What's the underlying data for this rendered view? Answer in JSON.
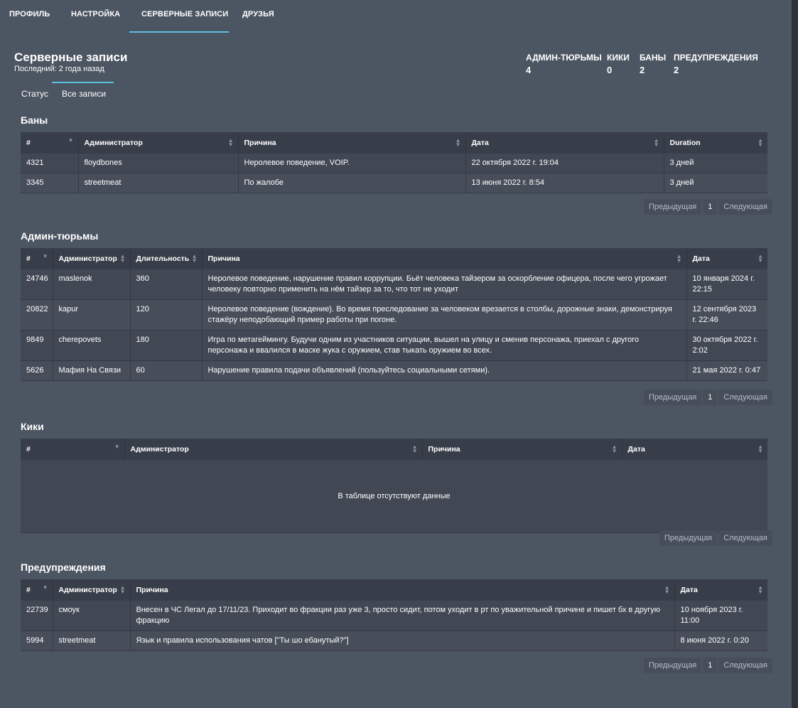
{
  "nav": {
    "tabs": [
      "ПРОФИЛЬ",
      "НАСТРОЙКА",
      "СЕРВЕРНЫЕ ЗАПИСИ",
      "ДРУЗЬЯ"
    ]
  },
  "header": {
    "title": "Серверные записи",
    "subtitle": "Последний: 2 года назад"
  },
  "stats": [
    {
      "label": "АДМИН-ТЮРЬМЫ",
      "value": "4"
    },
    {
      "label": "КИКИ",
      "value": "0"
    },
    {
      "label": "БАНЫ",
      "value": "2"
    },
    {
      "label": "ПРЕДУПРЕЖДЕНИЯ",
      "value": "2"
    }
  ],
  "subtabs": [
    "Статус",
    "Все записи"
  ],
  "pager": {
    "prev": "Предыдущая",
    "next": "Следующая",
    "page": "1"
  },
  "bans": {
    "title": "Баны",
    "columns": [
      "#",
      "Администратор",
      "Причина",
      "Дата",
      "Duration"
    ],
    "rows": [
      [
        "4321",
        "floydbones",
        "Неролевое поведение, VOIP.",
        "22 октября 2022 г. 19:04",
        "3 дней"
      ],
      [
        "3345",
        "streetmeat",
        "По жалобе",
        "13 июня 2022 г. 8:54",
        "3 дней"
      ]
    ]
  },
  "jails": {
    "title": "Админ-тюрьмы",
    "columns": [
      "#",
      "Администратор",
      "Длительность",
      "Причина",
      "Дата"
    ],
    "rows": [
      [
        "24746",
        "maslenok",
        "360",
        "Неролевое поведение, нарушение правил коррупции. Бьёт человека тайзером за оскорбление офицера, после чего угрожает человеку повторно применить на нём тайзер за то, что тот не уходит",
        "10 января 2024 г. 22:15"
      ],
      [
        "20822",
        "kapur",
        "120",
        "Неролевое поведение (вождение). Во время преследование за человеком врезается в столбы, дорожные знаки, демонстрируя стажёру неподобающий пример работы при погоне.",
        "12 сентября 2023 г. 22:46"
      ],
      [
        "9849",
        "cherepovets",
        "180",
        "Игра по метагеймингу. Будучи одним из участников ситуации, вышел на улицу и сменив персонажа, приехал с другого персонажа и ввалился в маске жука с оружием, став тыкать оружием во всех.",
        "30 октября 2022 г. 2:02"
      ],
      [
        "5626",
        "Мафия На Связи",
        "60",
        "Нарушение правила подачи объявлений (пользуйтесь социальными сетями).",
        "21 мая 2022 г. 0:47"
      ]
    ]
  },
  "kicks": {
    "title": "Кики",
    "columns": [
      "#",
      "Администратор",
      "Причина",
      "Дата"
    ],
    "empty": "В таблице отсутствуют данные"
  },
  "warnings": {
    "title": "Предупреждения",
    "columns": [
      "#",
      "Администратор",
      "Причина",
      "Дата"
    ],
    "rows": [
      [
        "22739",
        "смоук",
        "Внесен в ЧС Легал до 17/11/23. Приходит во фракции раз уже 3, просто сидит, потом уходит в рт по уважительной причине и пишет бх в другую фракцию",
        "10 ноября 2023 г. 11:00"
      ],
      [
        "5994",
        "streetmeat",
        "Язык и правила использования чатов [\"Ты шо ебанутый?\"]",
        "8 июня 2022 г. 0:20"
      ]
    ]
  }
}
